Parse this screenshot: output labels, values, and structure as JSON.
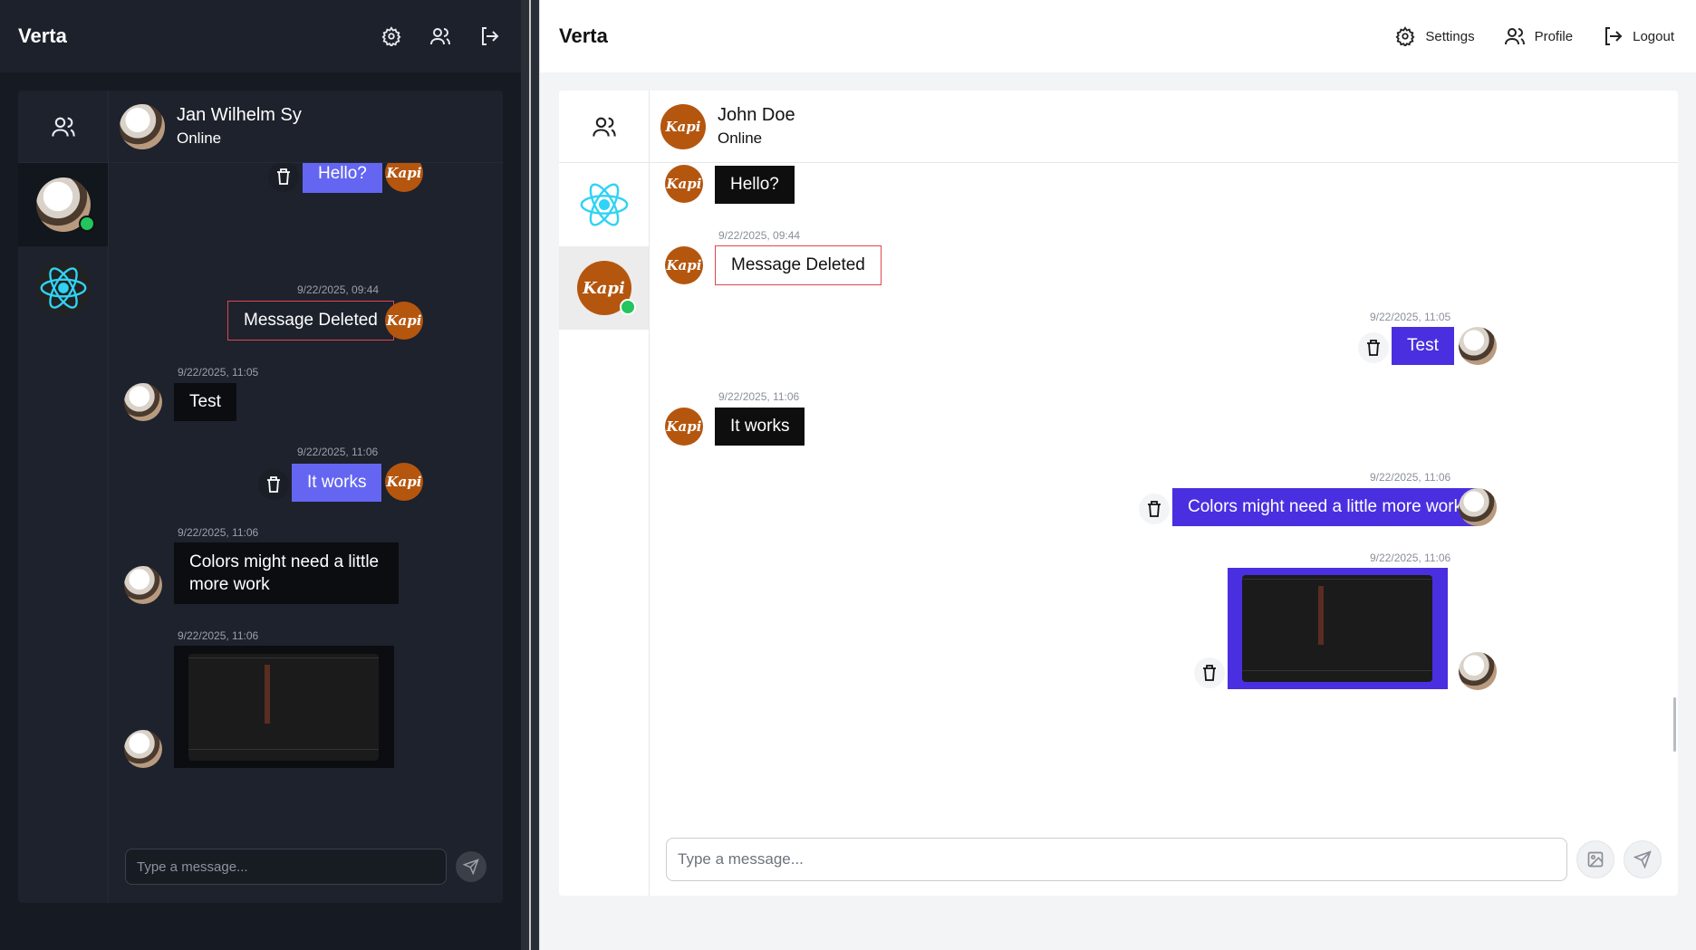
{
  "left": {
    "brand": "Verta",
    "chat": {
      "name": "Jan Wilhelm Sy",
      "status": "Online"
    },
    "messages": [
      {
        "text": "Hello?",
        "side": "mine"
      },
      {
        "time": "9/22/2025, 09:44",
        "text": "Message Deleted",
        "side": "mine"
      },
      {
        "time": "9/22/2025, 11:05",
        "text": "Test",
        "side": "theirs"
      },
      {
        "time": "9/22/2025, 11:06",
        "text": "It works",
        "side": "mine"
      },
      {
        "time": "9/22/2025, 11:06",
        "text": "Colors might need a little more work",
        "side": "theirs"
      },
      {
        "time": "9/22/2025, 11:06",
        "image": "screenshot",
        "side": "theirs"
      }
    ],
    "composer": {
      "placeholder": "Type a message..."
    }
  },
  "right": {
    "brand": "Verta",
    "nav": {
      "settings": "Settings",
      "profile": "Profile",
      "logout": "Logout"
    },
    "chat": {
      "name": "John Doe",
      "status": "Online"
    },
    "messages": [
      {
        "text": "Hello?",
        "side": "theirs"
      },
      {
        "time": "9/22/2025, 09:44",
        "text": "Message Deleted",
        "side": "theirs"
      },
      {
        "time": "9/22/2025, 11:05",
        "text": "Test",
        "side": "mine"
      },
      {
        "time": "9/22/2025, 11:06",
        "text": "It works",
        "side": "theirs"
      },
      {
        "time": "9/22/2025, 11:06",
        "text": "Colors might need a little more work",
        "side": "mine"
      },
      {
        "time": "9/22/2025, 11:06",
        "image": "screenshot",
        "side": "mine"
      }
    ],
    "composer": {
      "placeholder": "Type a message..."
    }
  },
  "avatar_text": "Kapi",
  "colors": {
    "accent_dark_mode": "#6466f1",
    "accent_light_mode": "#4a2fe0",
    "online": "#22c55e",
    "deleted_border": "#e0464e",
    "kapi_avatar": "#b5560f"
  },
  "icons": [
    "gear-icon",
    "users-icon",
    "logout-icon",
    "trash-icon",
    "image-icon",
    "send-icon",
    "react-logo-icon"
  ]
}
